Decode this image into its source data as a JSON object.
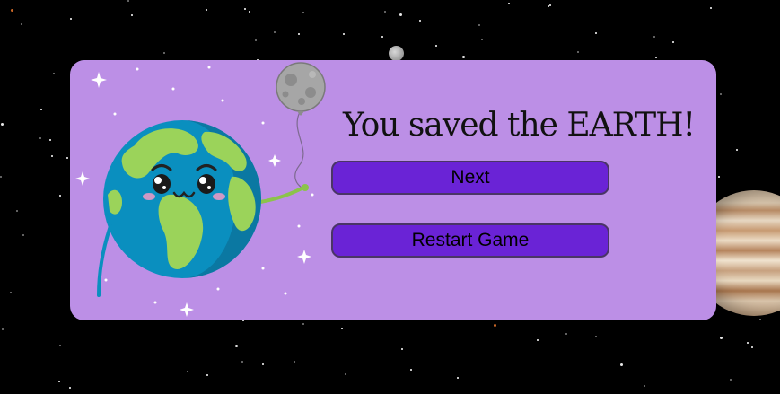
{
  "game": {
    "message": "You saved the EARTH!",
    "buttons": {
      "next": "Next",
      "restart": "Restart Game"
    }
  },
  "colors": {
    "panel": "#bc8fe6",
    "button": "#6a23d6",
    "space": "#000000"
  },
  "icons": {
    "earth": "smiling-earth-icon",
    "balloon": "moon-balloon-icon",
    "planet": "jupiter-icon",
    "moon": "moon-icon"
  }
}
